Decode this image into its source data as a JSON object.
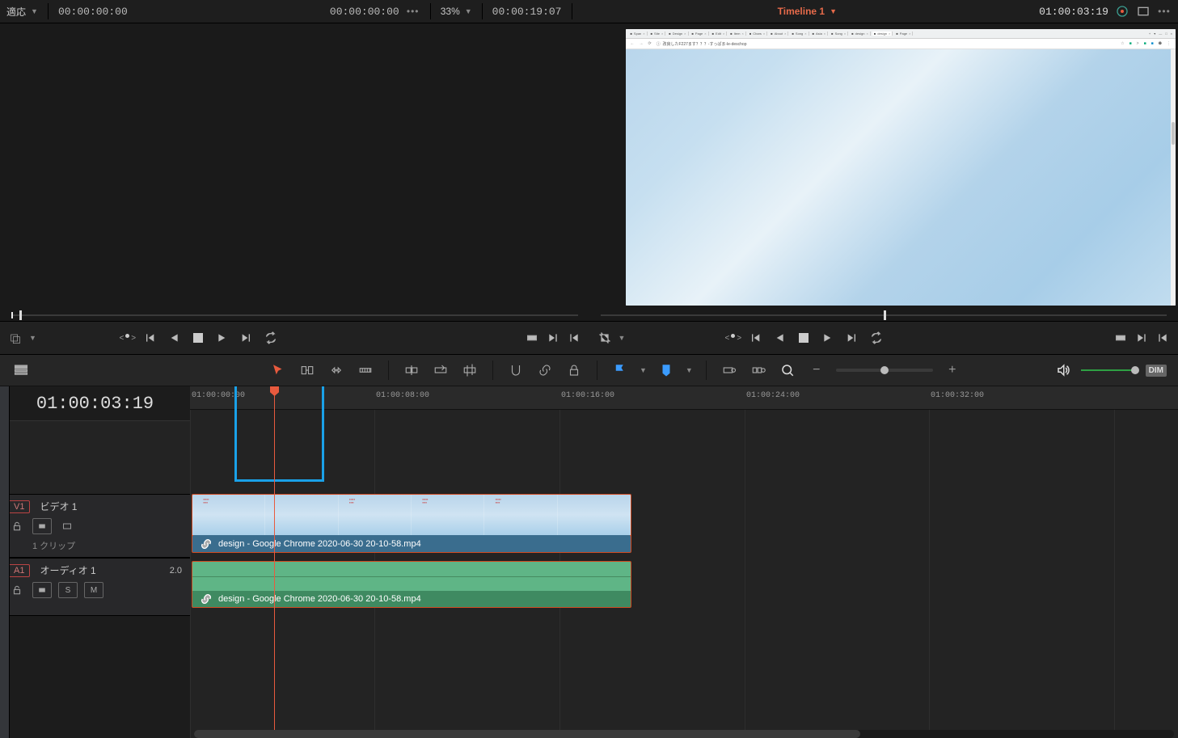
{
  "topbar": {
    "fit_label": "適応",
    "source_tc_left": "00:00:00:00",
    "source_tc_right": "00:00:00:00",
    "zoom_pct": "33%",
    "duration": "00:00:19:07",
    "timeline_name": "Timeline 1",
    "timeline_tc": "01:00:03:19"
  },
  "toolstrip": {
    "dim_label": "DIM"
  },
  "timeline": {
    "big_tc": "01:00:03:19",
    "ruler_labels": [
      "01:00:00:00",
      "01:00:08:00",
      "01:00:16:00",
      "01:00:24:00",
      "01:00:32:00"
    ],
    "video_track": {
      "tag": "V1",
      "name": "ビデオ 1",
      "clip_count": "1 クリップ"
    },
    "audio_track": {
      "tag": "A1",
      "name": "オーディオ 1",
      "channels": "2.0",
      "solo": "S",
      "mute": "M"
    },
    "clip_name": "design - Google Chrome 2020-06-30 20-10-58.mp4"
  }
}
